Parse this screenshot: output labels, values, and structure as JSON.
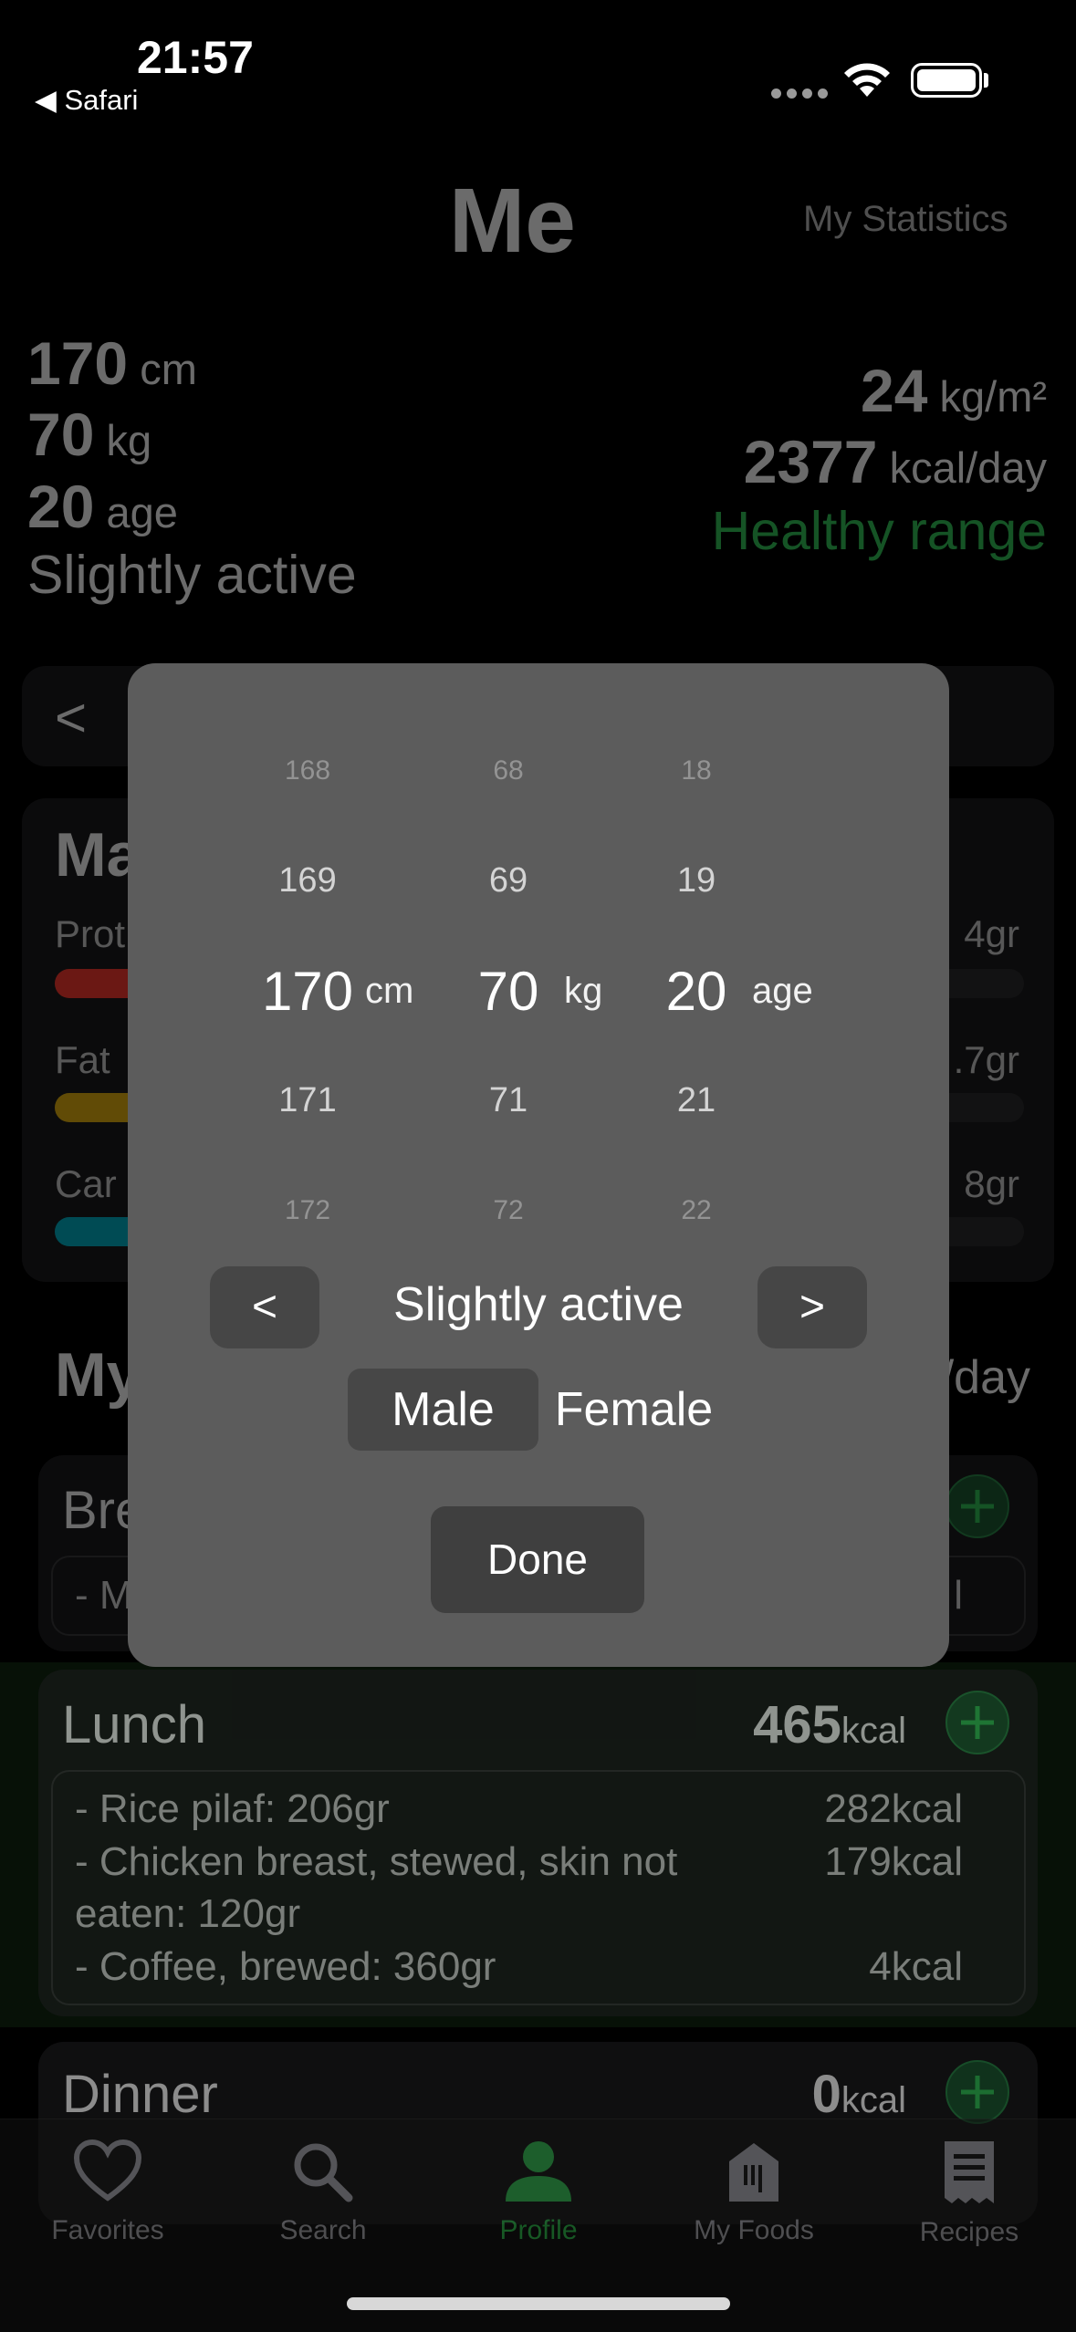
{
  "status_bar": {
    "time": "21:57",
    "back_app": "◀ Safari"
  },
  "header": {
    "title": "Me",
    "stats_link": "My Statistics"
  },
  "profile": {
    "height_value": "170",
    "height_unit": "cm",
    "weight_value": "70",
    "weight_unit": "kg",
    "age_value": "20",
    "age_unit": "age",
    "activity": "Slightly active",
    "bmi_value": "24",
    "bmi_unit": "kg/m²",
    "kcal_value": "2377",
    "kcal_unit": "kcal/day",
    "range_label": "Healthy range"
  },
  "day_nav": {
    "prev": "<"
  },
  "macros": {
    "title_partial": "Ma",
    "items": [
      {
        "label": "Prot",
        "value": "4gr",
        "color": "#ff3b30"
      },
      {
        "label": "Fat",
        "value": ".7gr",
        "color": "#e8b40f"
      },
      {
        "label": "Car",
        "value": "8gr",
        "color": "#00b4c8"
      }
    ]
  },
  "meals_header": {
    "title_partial": "My",
    "goal_partial": "/day"
  },
  "meals": {
    "breakfast": {
      "name_partial": "Bre",
      "item_partial": "- M",
      "kcal_partial": "l"
    },
    "lunch": {
      "name": "Lunch",
      "kcal_value": "465",
      "kcal_unit": "kcal",
      "items": [
        {
          "text": "- Rice pilaf:  206gr",
          "kcal": "282kcal"
        },
        {
          "text": "- Chicken breast, stewed, skin not",
          "kcal": "179kcal"
        },
        {
          "text": "eaten:  120gr",
          "kcal": ""
        },
        {
          "text": "- Coffee, brewed:  360gr",
          "kcal": "4kcal"
        }
      ]
    },
    "dinner": {
      "name": "Dinner",
      "kcal_value": "0",
      "kcal_unit": "kcal"
    }
  },
  "tabbar": {
    "tabs": [
      {
        "label": "Favorites",
        "icon": "heart-icon"
      },
      {
        "label": "Search",
        "icon": "search-icon"
      },
      {
        "label": "Profile",
        "icon": "person-icon",
        "active": true
      },
      {
        "label": "My Foods",
        "icon": "food-icon"
      },
      {
        "label": "Recipes",
        "icon": "receipt-icon"
      }
    ]
  },
  "picker": {
    "height": [
      "168",
      "169",
      "170",
      "171",
      "172"
    ],
    "weight": [
      "68",
      "69",
      "70",
      "71",
      "72"
    ],
    "age": [
      "18",
      "19",
      "20",
      "21",
      "22"
    ],
    "height_unit": "cm",
    "weight_unit": "kg",
    "age_unit": "age",
    "activity_prev": "<",
    "activity_label": "Slightly active",
    "activity_next": ">",
    "gender_male": "Male",
    "gender_female": "Female",
    "gender_selected": "Male",
    "done": "Done"
  }
}
